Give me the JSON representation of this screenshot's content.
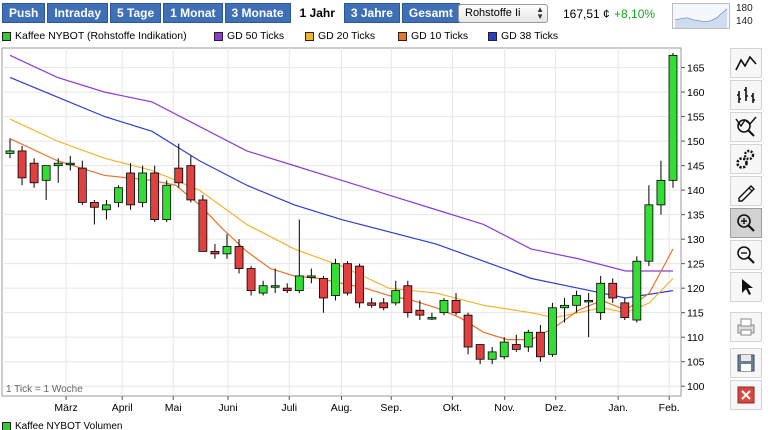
{
  "toolbar": {
    "tabs": [
      {
        "label": "Push"
      },
      {
        "label": "Intraday"
      },
      {
        "label": "5 Tage"
      },
      {
        "label": "1 Monat"
      },
      {
        "label": "3 Monate"
      },
      {
        "label": "1 Jahr",
        "active": true
      },
      {
        "label": "3 Jahre"
      },
      {
        "label": "Gesamt"
      }
    ],
    "select_value": "Rohstoffe Ii",
    "price": "167,51 ¢",
    "change": "+8,10%",
    "mini_chart": {
      "top_label": "180",
      "bottom_label": "140"
    }
  },
  "legend": [
    {
      "label": "Kaffee NYBOT (Rohstoffe Indikation)",
      "color": "#33cc33"
    },
    {
      "label": "GD 50 Ticks",
      "color": "#8e3bd6"
    },
    {
      "label": "GD 20 Ticks",
      "color": "#f1b52a"
    },
    {
      "label": "GD 10 Ticks",
      "color": "#e8732a"
    },
    {
      "label": "GD 38 Ticks",
      "color": "#2b3fcf"
    }
  ],
  "colors": {
    "up": "#33dd33",
    "down": "#e04040",
    "accent": "#3f6fb5"
  },
  "chart_data": {
    "type": "candlestick",
    "title": "Kaffee NYBOT (Rohstoffe Indikation)",
    "y_ticks": [
      100,
      105,
      110,
      115,
      120,
      125,
      130,
      135,
      140,
      145,
      150,
      155,
      160,
      165
    ],
    "ylim": [
      98,
      169
    ],
    "x_range": [
      0,
      52
    ],
    "x_ticks": [
      {
        "label": "März",
        "x": 4.4
      },
      {
        "label": "April",
        "x": 8.8
      },
      {
        "label": "Mai",
        "x": 12.8
      },
      {
        "label": "Juni",
        "x": 17.1
      },
      {
        "label": "Juli",
        "x": 21.9
      },
      {
        "label": "Aug.",
        "x": 26.0
      },
      {
        "label": "Sep.",
        "x": 29.9
      },
      {
        "label": "Okt.",
        "x": 34.7
      },
      {
        "label": "Nov.",
        "x": 38.8
      },
      {
        "label": "Dez.",
        "x": 42.8
      },
      {
        "label": "Jan.",
        "x": 47.7
      },
      {
        "label": "Feb.",
        "x": 51.7
      }
    ],
    "note": "1 Tick = 1 Woche",
    "candles": [
      {
        "o": 147.5,
        "h": 150.5,
        "l": 146.5,
        "c": 148.0
      },
      {
        "o": 148.0,
        "h": 149.0,
        "l": 141.0,
        "c": 142.5
      },
      {
        "o": 145.5,
        "h": 146.5,
        "l": 140.5,
        "c": 141.5
      },
      {
        "o": 142.0,
        "h": 143.0,
        "l": 138.0,
        "c": 145.0
      },
      {
        "o": 145.0,
        "h": 146.5,
        "l": 141.5,
        "c": 145.5
      },
      {
        "o": 145.5,
        "h": 147.0,
        "l": 144.0,
        "c": 145.5
      },
      {
        "o": 144.5,
        "h": 146.0,
        "l": 137.0,
        "c": 137.5
      },
      {
        "o": 137.5,
        "h": 138.0,
        "l": 133.0,
        "c": 136.5
      },
      {
        "o": 136.0,
        "h": 138.0,
        "l": 134.0,
        "c": 137.0
      },
      {
        "o": 137.5,
        "h": 141.0,
        "l": 136.5,
        "c": 140.5
      },
      {
        "o": 143.5,
        "h": 145.5,
        "l": 136.0,
        "c": 137.0
      },
      {
        "o": 137.5,
        "h": 145.0,
        "l": 136.5,
        "c": 143.5
      },
      {
        "o": 143.5,
        "h": 145.0,
        "l": 133.5,
        "c": 134.0
      },
      {
        "o": 134.0,
        "h": 142.0,
        "l": 133.5,
        "c": 141.0
      },
      {
        "o": 144.5,
        "h": 149.5,
        "l": 140.5,
        "c": 141.5
      },
      {
        "o": 145.0,
        "h": 147.0,
        "l": 137.5,
        "c": 138.0
      },
      {
        "o": 138.0,
        "h": 139.0,
        "l": 128.0,
        "c": 127.5
      },
      {
        "o": 127.5,
        "h": 129.0,
        "l": 126.0,
        "c": 127.0
      },
      {
        "o": 127.0,
        "h": 131.0,
        "l": 126.0,
        "c": 128.5
      },
      {
        "o": 128.5,
        "h": 130.0,
        "l": 123.0,
        "c": 124.0
      },
      {
        "o": 124.0,
        "h": 124.5,
        "l": 118.5,
        "c": 119.5
      },
      {
        "o": 119.0,
        "h": 121.5,
        "l": 118.5,
        "c": 120.5
      },
      {
        "o": 120.5,
        "h": 124.0,
        "l": 119.0,
        "c": 120.5
      },
      {
        "o": 120.0,
        "h": 121.0,
        "l": 119.0,
        "c": 119.5
      },
      {
        "o": 119.5,
        "h": 134.0,
        "l": 119.0,
        "c": 122.5
      },
      {
        "o": 122.5,
        "h": 124.0,
        "l": 121.0,
        "c": 122.5
      },
      {
        "o": 122.0,
        "h": 122.5,
        "l": 115.0,
        "c": 118.0
      },
      {
        "o": 118.5,
        "h": 126.0,
        "l": 117.5,
        "c": 125.0
      },
      {
        "o": 125.0,
        "h": 125.5,
        "l": 118.5,
        "c": 119.0
      },
      {
        "o": 124.5,
        "h": 125.0,
        "l": 116.0,
        "c": 117.0
      },
      {
        "o": 117.0,
        "h": 118.0,
        "l": 116.0,
        "c": 116.5
      },
      {
        "o": 117.0,
        "h": 118.0,
        "l": 115.5,
        "c": 116.0
      },
      {
        "o": 117.0,
        "h": 121.5,
        "l": 116.5,
        "c": 119.5
      },
      {
        "o": 120.5,
        "h": 121.5,
        "l": 114.0,
        "c": 115.0
      },
      {
        "o": 115.5,
        "h": 117.5,
        "l": 113.5,
        "c": 114.5
      },
      {
        "o": 114.0,
        "h": 115.0,
        "l": 113.5,
        "c": 114.0
      },
      {
        "o": 115.0,
        "h": 118.0,
        "l": 114.5,
        "c": 117.5
      },
      {
        "o": 117.5,
        "h": 119.0,
        "l": 114.5,
        "c": 115.0
      },
      {
        "o": 114.5,
        "h": 115.0,
        "l": 106.5,
        "c": 108.0
      },
      {
        "o": 108.5,
        "h": 108.5,
        "l": 104.5,
        "c": 105.5
      },
      {
        "o": 105.5,
        "h": 108.0,
        "l": 104.5,
        "c": 107.0
      },
      {
        "o": 106.0,
        "h": 110.0,
        "l": 105.5,
        "c": 109.0
      },
      {
        "o": 108.5,
        "h": 110.5,
        "l": 107.0,
        "c": 107.5
      },
      {
        "o": 108.0,
        "h": 111.5,
        "l": 107.0,
        "c": 111.0
      },
      {
        "o": 111.0,
        "h": 112.5,
        "l": 105.0,
        "c": 106.0
      },
      {
        "o": 106.5,
        "h": 117.0,
        "l": 106.0,
        "c": 116.0
      },
      {
        "o": 116.0,
        "h": 118.0,
        "l": 113.0,
        "c": 116.5
      },
      {
        "o": 116.5,
        "h": 119.5,
        "l": 115.0,
        "c": 118.5
      },
      {
        "o": 117.5,
        "h": 119.0,
        "l": 110.0,
        "c": 117.5
      },
      {
        "o": 115.0,
        "h": 122.5,
        "l": 113.5,
        "c": 121.0
      },
      {
        "o": 121.0,
        "h": 122.0,
        "l": 117.0,
        "c": 118.0
      },
      {
        "o": 117.0,
        "h": 118.0,
        "l": 113.5,
        "c": 114.0
      },
      {
        "o": 113.5,
        "h": 126.5,
        "l": 113.0,
        "c": 125.5
      },
      {
        "o": 125.5,
        "h": 141.0,
        "l": 124.5,
        "c": 137.0
      },
      {
        "o": 137.0,
        "h": 146.0,
        "l": 135.0,
        "c": 142.0
      },
      {
        "o": 142.0,
        "h": 168.0,
        "l": 140.5,
        "c": 167.5
      }
    ],
    "series": [
      {
        "name": "GD 50 Ticks",
        "color": "#8e3bd6",
        "points": [
          [
            0,
            167.5
          ],
          [
            4,
            163
          ],
          [
            8,
            160
          ],
          [
            12,
            158
          ],
          [
            16,
            153
          ],
          [
            20,
            148
          ],
          [
            24,
            145
          ],
          [
            28,
            142
          ],
          [
            32,
            139
          ],
          [
            36,
            136
          ],
          [
            40,
            133
          ],
          [
            44,
            128
          ],
          [
            48,
            126
          ],
          [
            52,
            123.5
          ],
          [
            56,
            123.5
          ]
        ]
      },
      {
        "name": "GD 38 Ticks",
        "color": "#2b3fcf",
        "points": [
          [
            0,
            163
          ],
          [
            4,
            159
          ],
          [
            8,
            155
          ],
          [
            12,
            152
          ],
          [
            16,
            146
          ],
          [
            20,
            141
          ],
          [
            24,
            137
          ],
          [
            28,
            134
          ],
          [
            32,
            131.5
          ],
          [
            36,
            129
          ],
          [
            40,
            125.5
          ],
          [
            44,
            122
          ],
          [
            48,
            120
          ],
          [
            52,
            118
          ],
          [
            56,
            119.5
          ]
        ]
      },
      {
        "name": "GD 20 Ticks",
        "color": "#f1b52a",
        "points": [
          [
            0,
            154.5
          ],
          [
            4,
            150
          ],
          [
            8,
            146.5
          ],
          [
            12,
            144
          ],
          [
            16,
            140
          ],
          [
            20,
            133
          ],
          [
            24,
            128
          ],
          [
            28,
            124.5
          ],
          [
            32,
            120
          ],
          [
            36,
            119
          ],
          [
            40,
            116.5
          ],
          [
            44,
            115
          ],
          [
            46,
            114
          ],
          [
            48,
            115
          ],
          [
            50,
            116
          ],
          [
            52,
            115
          ],
          [
            54,
            117
          ],
          [
            56,
            122
          ]
        ]
      },
      {
        "name": "GD 10 Ticks",
        "color": "#e8732a",
        "points": [
          [
            0,
            150.5
          ],
          [
            4,
            146
          ],
          [
            8,
            143
          ],
          [
            12,
            142
          ],
          [
            14,
            141
          ],
          [
            16,
            137
          ],
          [
            18,
            132
          ],
          [
            20,
            127.5
          ],
          [
            22,
            124
          ],
          [
            24,
            122.5
          ],
          [
            26,
            122
          ],
          [
            28,
            121
          ],
          [
            30,
            120
          ],
          [
            32,
            118.5
          ],
          [
            34,
            117.5
          ],
          [
            36,
            116
          ],
          [
            38,
            114
          ],
          [
            40,
            111
          ],
          [
            42,
            109.5
          ],
          [
            44,
            109.5
          ],
          [
            46,
            112
          ],
          [
            48,
            115.5
          ],
          [
            50,
            117.5
          ],
          [
            52,
            115.5
          ],
          [
            54,
            119
          ],
          [
            56,
            128
          ]
        ]
      }
    ]
  },
  "bottom_legend": {
    "label": "Kaffee NYBOT Volumen"
  }
}
